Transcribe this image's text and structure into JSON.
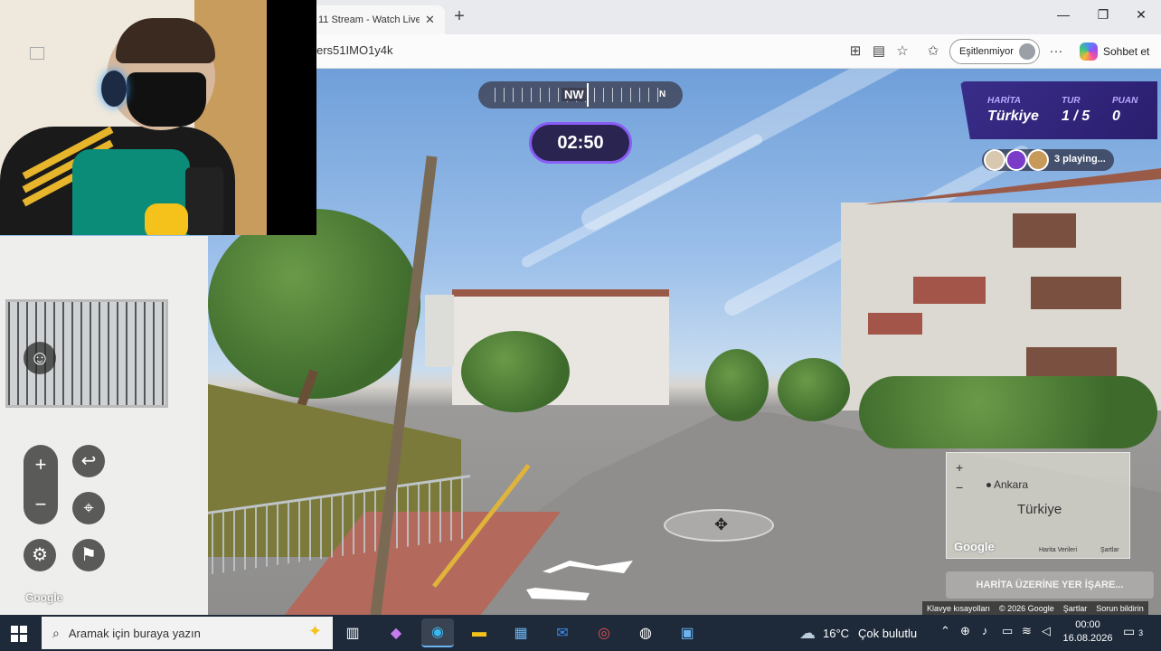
{
  "browser": {
    "tab_title": "11 Stream - Watch Live",
    "tab_close": "✕",
    "new_tab": "+",
    "url": "ers51IMO1y4k",
    "window_controls": {
      "minimize": "—",
      "maximize": "❐",
      "close": "✕"
    },
    "sync_label": "Eşitlenmiyor",
    "more": "···",
    "copilot_label": "Sohbet et"
  },
  "game": {
    "compass": {
      "heading": "NW",
      "north": "N"
    },
    "timer": "02:50",
    "info": {
      "map_label": "HARİTA",
      "map_value": "Türkiye",
      "round_label": "TUR",
      "round_value": "1 / 5",
      "score_label": "PUAN",
      "score_value": "0"
    },
    "players_text": "3 playing...",
    "controls": {
      "emote": "☺",
      "zoom_in": "+",
      "zoom_out": "−",
      "undo": "↩",
      "pin": "⌖",
      "settings": "⚙",
      "flag": "⚑"
    },
    "minimap": {
      "zoom_in": "+",
      "zoom_out": "−",
      "city": "Ankara",
      "country": "Türkiye",
      "logo": "Google",
      "map_data": "Harita Verileri",
      "terms": "Şartlar"
    },
    "guess_button": "HARİTA ÜZERİNE YER İŞARE...",
    "move_icon": "✥"
  },
  "streetview": {
    "google_logo": "Google",
    "footer": [
      "Klavye kısayolları",
      "© 2026 Google",
      "Şartlar",
      "Sorun bildirin"
    ]
  },
  "taskbar": {
    "search_placeholder": "Aramak için buraya yazın",
    "weather_temp": "16°C",
    "weather_text": "Çok bulutlu",
    "time": "00:00",
    "date": "16.08.2026",
    "notifications": "3"
  }
}
